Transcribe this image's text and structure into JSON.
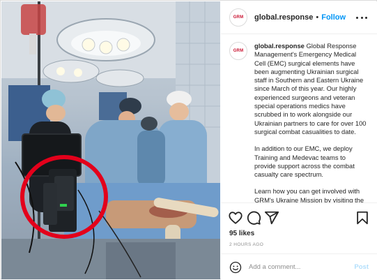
{
  "account": {
    "username": "global.response",
    "logo_text": "GRM",
    "separator": "•",
    "follow_label": "Follow"
  },
  "caption": {
    "username": "global.response",
    "paragraphs": [
      "Global Response Management's Emergency Medical Cell (EMC) surgical elements have been augmenting Ukrainian surgical staff in Southern and Eastern Ukraine since March of this year. Our highly experienced surgeons and veteran special operations medics have scrubbed in to work alongside our Ukrainian partners to care for over 100 surgical combat casualities to date.",
      "In addition to our EMC, we deploy Training and Medevac teams to provide support across the combat casualty care spectrum.",
      "Learn how you can get involved with GRM's Ukraine Mission by visiting the"
    ]
  },
  "post": {
    "likes": "95 likes",
    "timestamp": "2 HOURS AGO"
  },
  "comment": {
    "placeholder": "Add a comment...",
    "post_label": "Post"
  },
  "icons": {
    "like": "heart-icon",
    "comment": "comment-icon",
    "share": "share-icon",
    "save": "bookmark-icon",
    "emoji": "emoji-icon",
    "more": "more-options-icon"
  },
  "colors": {
    "accent": "#0095f6",
    "post_disabled": "#b2dffc",
    "brand_red": "#c8102e",
    "highlight_circle": "#e3001b"
  }
}
